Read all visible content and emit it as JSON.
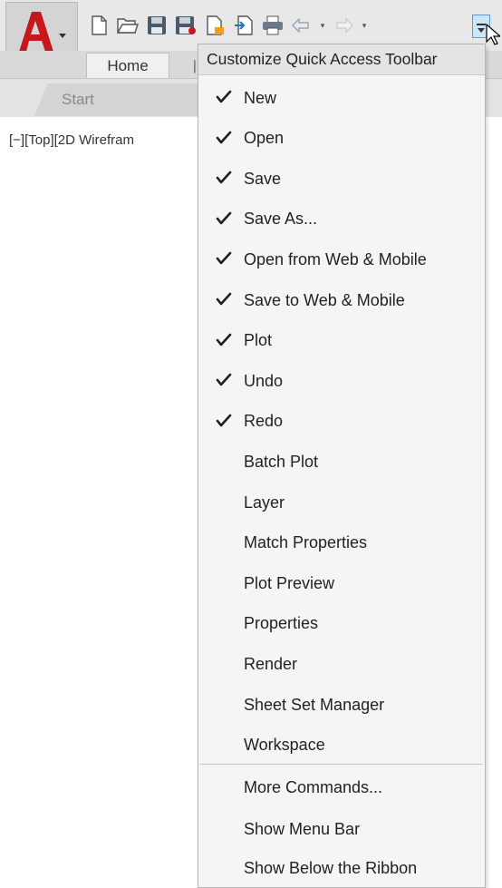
{
  "ribbon": {
    "home_tab": "Home"
  },
  "file_tabs": {
    "start": "Start"
  },
  "viewport": {
    "label": "[−][Top][2D Wirefram"
  },
  "menu": {
    "header": "Customize Quick Access Toolbar",
    "items": [
      {
        "label": "New",
        "checked": true
      },
      {
        "label": "Open",
        "checked": true
      },
      {
        "label": "Save",
        "checked": true
      },
      {
        "label": "Save As...",
        "checked": true
      },
      {
        "label": "Open from Web & Mobile",
        "checked": true
      },
      {
        "label": "Save to Web & Mobile",
        "checked": true
      },
      {
        "label": "Plot",
        "checked": true
      },
      {
        "label": "Undo",
        "checked": true
      },
      {
        "label": "Redo",
        "checked": true
      },
      {
        "label": "Batch Plot",
        "checked": false
      },
      {
        "label": "Layer",
        "checked": false
      },
      {
        "label": "Match Properties",
        "checked": false
      },
      {
        "label": "Plot Preview",
        "checked": false
      },
      {
        "label": "Properties",
        "checked": false
      },
      {
        "label": "Render",
        "checked": false
      },
      {
        "label": "Sheet Set Manager",
        "checked": false
      },
      {
        "label": "Workspace",
        "checked": false
      }
    ],
    "extra_items": [
      {
        "label": "More Commands..."
      },
      {
        "label": "Show Menu Bar"
      },
      {
        "label": "Show Below the Ribbon"
      }
    ]
  },
  "colors": {
    "accent": "#c8161d",
    "highlight": "#cde4f7"
  }
}
